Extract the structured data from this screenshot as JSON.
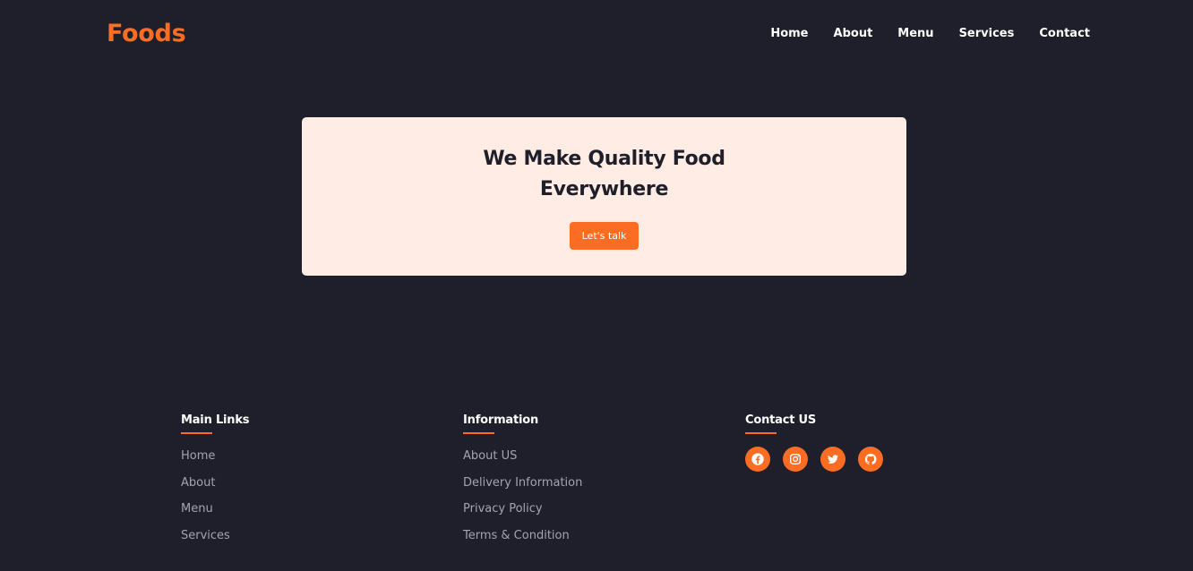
{
  "header": {
    "logo": "Foods",
    "nav": [
      "Home",
      "About",
      "Menu",
      "Services",
      "Contact"
    ]
  },
  "hero": {
    "title_line1": "We Make Quality Food",
    "title_line2": "Everywhere",
    "cta_label": "Let's talk"
  },
  "footer": {
    "main_links": {
      "heading": "Main Links",
      "items": [
        "Home",
        "About",
        "Menu",
        "Services"
      ]
    },
    "information": {
      "heading": "Information",
      "items": [
        "About US",
        "Delivery Information",
        "Privacy Policy",
        "Terms & Condition"
      ]
    },
    "contact": {
      "heading": "Contact US",
      "socials": [
        "facebook-icon",
        "instagram-icon",
        "twitter-icon",
        "github-icon"
      ]
    }
  },
  "colors": {
    "background": "#1e1f2a",
    "accent": "#fb6d23",
    "card": "#ffede5"
  }
}
